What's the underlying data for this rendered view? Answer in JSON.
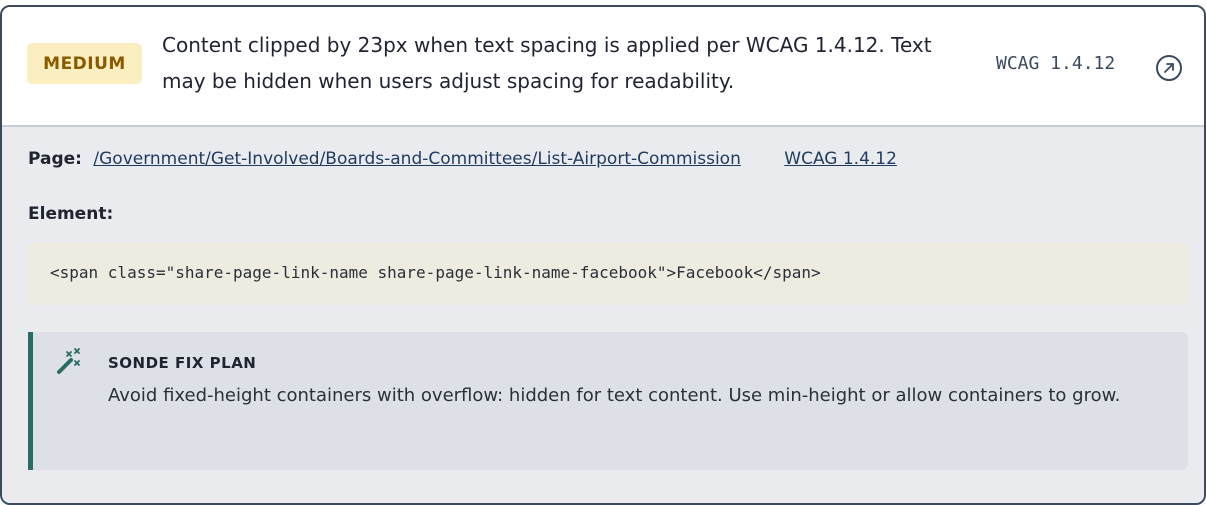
{
  "issue": {
    "severity": "MEDIUM",
    "message": "Content clipped by 23px when text spacing is applied per WCAG 1.4.12. Text may be hidden when users adjust spacing for readability.",
    "criterion": "WCAG 1.4.12",
    "open_icon": "external-link-icon"
  },
  "details": {
    "page_label": "Page:",
    "page_url": "/Government/Get-Involved/Boards-and-Committees/List-Airport-Commission",
    "wcag_link": "WCAG 1.4.12",
    "element_label": "Element:",
    "element_code": "<span class=\"share-page-link-name share-page-link-name-facebook\">Facebook</span>"
  },
  "fix_plan": {
    "icon": "magic-wand-icon",
    "title": "SONDE FIX PLAN",
    "text": "Avoid fixed-height containers with overflow: hidden for text content. Use min-height or allow containers to grow."
  },
  "colors": {
    "severity_bg": "#fbefc1",
    "severity_text": "#8a5a00",
    "accent": "#2a6b63",
    "link": "#1f3a5f"
  }
}
